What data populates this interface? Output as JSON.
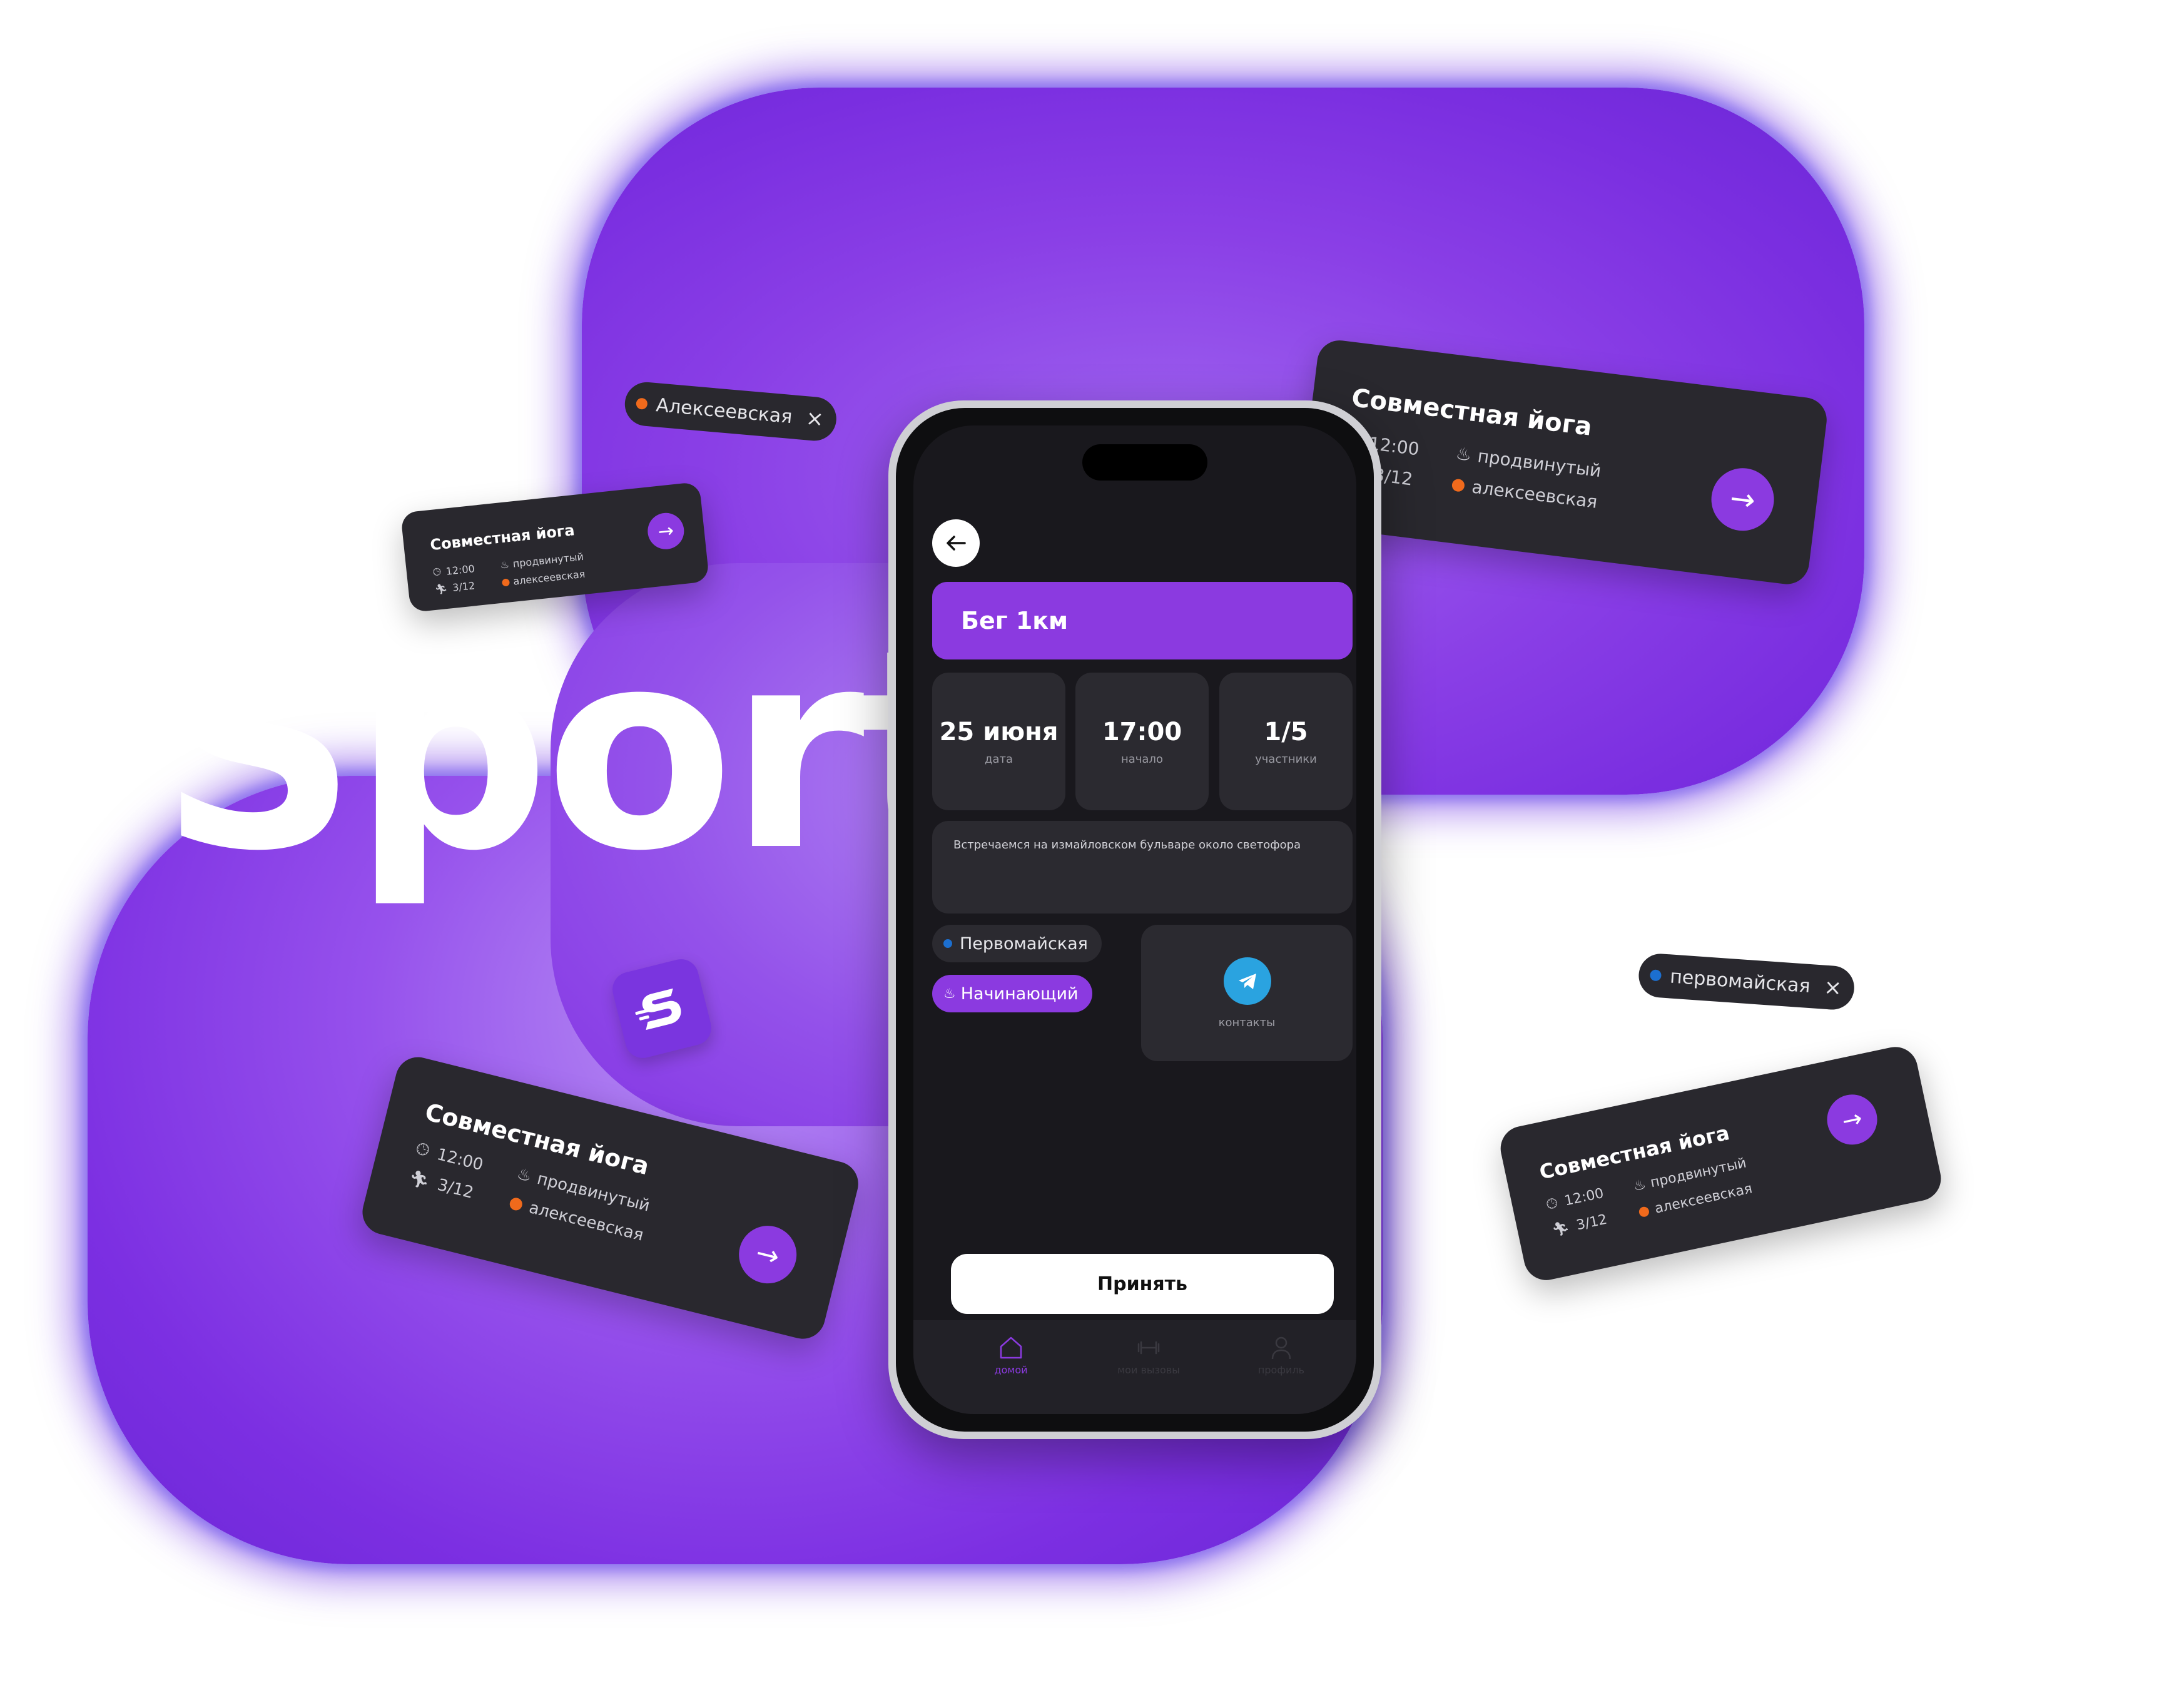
{
  "brand": {
    "name": "Sport"
  },
  "colors": {
    "accent": "#8b3ae0",
    "card_bg": "#29282e",
    "metro_orange": "#f06a1c",
    "metro_blue": "#1c6fd0",
    "telegram": "#2aa3e0"
  },
  "chips": [
    {
      "text": "Алексеевская",
      "close": "×",
      "dot_color": "#f06a1c"
    },
    {
      "text": "первомайская",
      "close": "×",
      "dot_color": "#1c6fd0"
    }
  ],
  "cards": [
    {
      "title": "Совместная йога",
      "time": "12:00",
      "level": "продвинутый",
      "participants": "3/12",
      "station": "алексеевская"
    },
    {
      "title": "Совместная йога",
      "time": "12:00",
      "level": "продвинутый",
      "participants": "3/12",
      "station": "алексеевская"
    },
    {
      "title": "Совместная йога",
      "time": "12:00",
      "level": "продвинутый",
      "participants": "3/12",
      "station": "алексеевская"
    },
    {
      "title": "Совместная йога",
      "time": "12:00",
      "level": "продвинутый",
      "participants": "3/12",
      "station": "алексеевская"
    }
  ],
  "phone": {
    "event_title": "Бег 1км",
    "tiles": [
      {
        "value": "25 июня",
        "label": "дата"
      },
      {
        "value": "17:00",
        "label": "начало"
      },
      {
        "value": "1/5",
        "label": "участники"
      }
    ],
    "description": "Встречаемся на измайловском бульваре около светофора",
    "station_pill": "Первомайская",
    "level_pill": "Начинающий",
    "contacts_label": "контакты",
    "accept_label": "Принять",
    "tabs": [
      {
        "label": "домой",
        "icon": "home-icon"
      },
      {
        "label": "мои вызовы",
        "icon": "dumbbell-icon"
      },
      {
        "label": "профиль",
        "icon": "profile-icon"
      }
    ]
  }
}
